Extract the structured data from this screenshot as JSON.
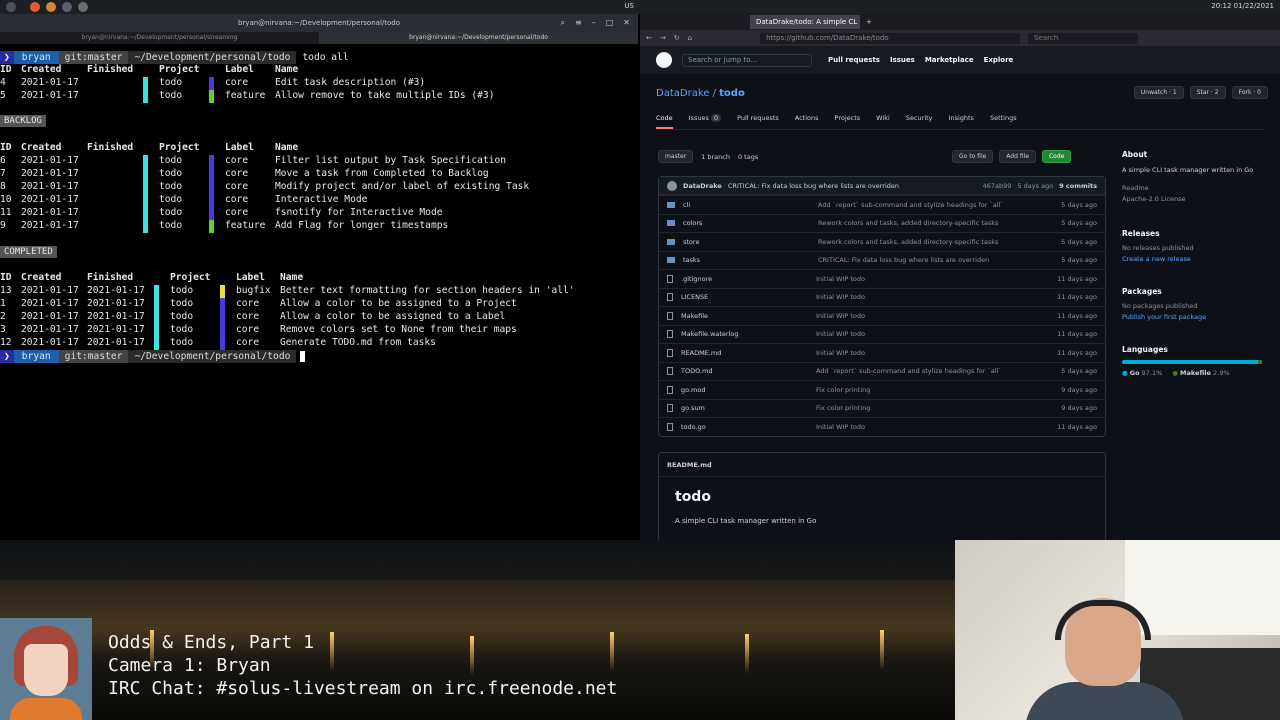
{
  "sysbar": {
    "keyboard": "US",
    "clock": "20:12 01/22/2021"
  },
  "terminal": {
    "title": "bryan@nirvana:~/Development/personal/todo",
    "tabs": [
      "bryan@nirvana:~/Development/personal/streaming",
      "bryan@nirvana:~/Development/personal/todo"
    ],
    "prompt": {
      "user": "bryan",
      "git": "git:master",
      "dir": "~/Development/personal/todo",
      "command": "todo all"
    },
    "headers": {
      "id": "ID",
      "created": "Created",
      "finished": "Finished",
      "project": "Project",
      "label": "Label",
      "name": "Name"
    },
    "active": [
      {
        "id": "4",
        "created": "2021-01-17",
        "finished": "",
        "project": "todo",
        "label": "core",
        "name": "Edit task description (#3)",
        "pcolor": "#3ee0e0",
        "lcolor": "#4a3bd9"
      },
      {
        "id": "5",
        "created": "2021-01-17",
        "finished": "",
        "project": "todo",
        "label": "feature",
        "name": "Allow remove to take multiple IDs (#3)",
        "pcolor": "#3ee0e0",
        "lcolor": "#5ad13a"
      }
    ],
    "backlog_label": "BACKLOG",
    "backlog": [
      {
        "id": "6",
        "created": "2021-01-17",
        "finished": "",
        "project": "todo",
        "label": "core",
        "name": "Filter list output by Task Specification",
        "pcolor": "#3ee0e0",
        "lcolor": "#4a3bd9"
      },
      {
        "id": "7",
        "created": "2021-01-17",
        "finished": "",
        "project": "todo",
        "label": "core",
        "name": "Move a task from Completed to Backlog",
        "pcolor": "#3ee0e0",
        "lcolor": "#4a3bd9"
      },
      {
        "id": "8",
        "created": "2021-01-17",
        "finished": "",
        "project": "todo",
        "label": "core",
        "name": "Modify project and/or label of existing Task",
        "pcolor": "#3ee0e0",
        "lcolor": "#4a3bd9"
      },
      {
        "id": "10",
        "created": "2021-01-17",
        "finished": "",
        "project": "todo",
        "label": "core",
        "name": "Interactive Mode",
        "pcolor": "#3ee0e0",
        "lcolor": "#4a3bd9"
      },
      {
        "id": "11",
        "created": "2021-01-17",
        "finished": "",
        "project": "todo",
        "label": "core",
        "name": "fsnotify for Interactive Mode",
        "pcolor": "#3ee0e0",
        "lcolor": "#4a3bd9"
      },
      {
        "id": "9",
        "created": "2021-01-17",
        "finished": "",
        "project": "todo",
        "label": "feature",
        "name": "Add Flag for longer timestamps",
        "pcolor": "#3ee0e0",
        "lcolor": "#5ad13a"
      }
    ],
    "completed_label": "COMPLETED",
    "completed": [
      {
        "id": "13",
        "created": "2021-01-17",
        "finished": "2021-01-17",
        "project": "todo",
        "label": "bugfix",
        "name": "Better text formatting for section headers in 'all'",
        "pcolor": "#3ee0e0",
        "lcolor": "#e8e040"
      },
      {
        "id": "1",
        "created": "2021-01-17",
        "finished": "2021-01-17",
        "project": "todo",
        "label": "core",
        "name": "Allow a color to be assigned to a Project",
        "pcolor": "#3ee0e0",
        "lcolor": "#4a3bd9"
      },
      {
        "id": "2",
        "created": "2021-01-17",
        "finished": "2021-01-17",
        "project": "todo",
        "label": "core",
        "name": "Allow a color to be assigned to a Label",
        "pcolor": "#3ee0e0",
        "lcolor": "#4a3bd9"
      },
      {
        "id": "3",
        "created": "2021-01-17",
        "finished": "2021-01-17",
        "project": "todo",
        "label": "core",
        "name": "Remove colors set to None from their maps",
        "pcolor": "#3ee0e0",
        "lcolor": "#4a3bd9"
      },
      {
        "id": "12",
        "created": "2021-01-17",
        "finished": "2021-01-17",
        "project": "todo",
        "label": "core",
        "name": "Generate TODO.md from tasks",
        "pcolor": "#3ee0e0",
        "lcolor": "#4a3bd9"
      }
    ]
  },
  "browser": {
    "tab_title": "DataDrake/todo: A simple CL",
    "url": "https://github.com/DataDrake/todo",
    "search_placeholder": "Search",
    "gh": {
      "search": "Search or jump to...",
      "nav": [
        "Pull requests",
        "Issues",
        "Marketplace",
        "Explore"
      ],
      "owner": "DataDrake",
      "repo": "todo",
      "unwatch": "Unwatch",
      "unwatch_count": "1",
      "star": "Star",
      "star_count": "2",
      "fork": "Fork",
      "fork_count": "0",
      "tabs": [
        "Code",
        "Issues",
        "Pull requests",
        "Actions",
        "Projects",
        "Wiki",
        "Security",
        "Insights",
        "Settings"
      ],
      "issues_count": "0",
      "branch": "master",
      "branches": "1 branch",
      "tags": "0 tags",
      "goto": "Go to file",
      "addfile": "Add file",
      "code": "Code",
      "commit_author": "DataDrake",
      "commit_msg": "CRITICAL: Fix data loss bug where lists are overriden",
      "commit_hash": "467ab99",
      "commit_when": "5 days ago",
      "commit_count": "9 commits",
      "files": [
        {
          "name": "cli",
          "type": "dir",
          "msg": "Add `report` sub-command and stylize headings for `all`",
          "date": "5 days ago"
        },
        {
          "name": "colors",
          "type": "dir",
          "msg": "Rework colors and tasks, added directory-specific tasks",
          "date": "5 days ago"
        },
        {
          "name": "store",
          "type": "dir",
          "msg": "Rework colors and tasks, added directory-specific tasks",
          "date": "5 days ago"
        },
        {
          "name": "tasks",
          "type": "dir",
          "msg": "CRITICAL: Fix data loss bug where lists are overriden",
          "date": "5 days ago"
        },
        {
          "name": ".gitignore",
          "type": "file",
          "msg": "Initial WIP todo",
          "date": "11 days ago"
        },
        {
          "name": "LICENSE",
          "type": "file",
          "msg": "Initial WIP todo",
          "date": "11 days ago"
        },
        {
          "name": "Makefile",
          "type": "file",
          "msg": "Initial WIP todo",
          "date": "11 days ago"
        },
        {
          "name": "Makefile.waterlog",
          "type": "file",
          "msg": "Initial WIP todo",
          "date": "11 days ago"
        },
        {
          "name": "README.md",
          "type": "file",
          "msg": "Initial WIP todo",
          "date": "11 days ago"
        },
        {
          "name": "TODO.md",
          "type": "file",
          "msg": "Add `report` sub-command and stylize headings for `all`",
          "date": "5 days ago"
        },
        {
          "name": "go.mod",
          "type": "file",
          "msg": "Fix color printing",
          "date": "9 days ago"
        },
        {
          "name": "go.sum",
          "type": "file",
          "msg": "Fix color printing",
          "date": "9 days ago"
        },
        {
          "name": "todo.go",
          "type": "file",
          "msg": "Initial WIP todo",
          "date": "11 days ago"
        }
      ],
      "about_h": "About",
      "about_desc": "A simple CLI task manager written in Go",
      "readme_link": "Readme",
      "license_link": "Apache-2.0 License",
      "releases_h": "Releases",
      "releases_none": "No releases published",
      "releases_create": "Create a new release",
      "packages_h": "Packages",
      "packages_none": "No packages published",
      "packages_publish": "Publish your first package",
      "languages_h": "Languages",
      "lang_go": "Go",
      "lang_go_pct": "97.1%",
      "lang_make": "Makefile",
      "lang_make_pct": "2.9%",
      "readme_file": "README.md",
      "readme_title": "todo",
      "readme_desc": "A simple CLI task manager written in Go"
    }
  },
  "overlay": {
    "line1": "Odds & Ends, Part 1",
    "line2": "Camera 1: Bryan",
    "line3": "IRC Chat: #solus-livestream on irc.freenode.net"
  }
}
